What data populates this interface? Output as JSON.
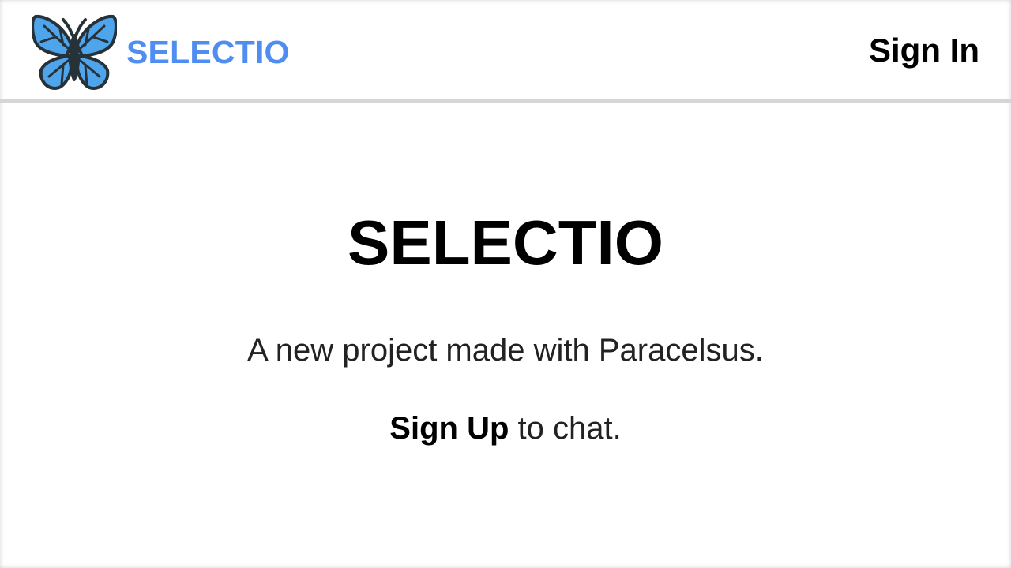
{
  "header": {
    "brand_name": "SELECTIO",
    "logo_icon": "butterfly-icon",
    "sign_in_label": "Sign In"
  },
  "hero": {
    "title": "SELECTIO",
    "tagline": "A new project made with Paracelsus.",
    "signup_link": "Sign Up",
    "signup_suffix": " to chat."
  },
  "colors": {
    "brand": "#4f8ef0",
    "butterfly_wing": "#4fa5ec",
    "butterfly_outline": "#263238",
    "divider": "#d6d6d6"
  }
}
